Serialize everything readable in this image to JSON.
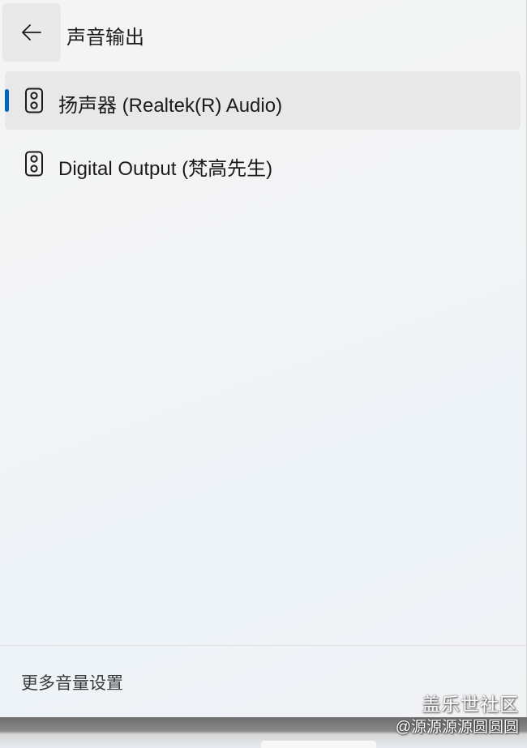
{
  "header": {
    "back_icon": "arrow-left-icon",
    "title": "声音输出"
  },
  "devices": [
    {
      "label": "扬声器 (Realtek(R) Audio)",
      "icon": "speaker-icon",
      "selected": true
    },
    {
      "label": "Digital Output (梵高先生)",
      "icon": "speaker-icon",
      "selected": false
    }
  ],
  "footer": {
    "more_settings_label": "更多音量设置"
  },
  "watermark": {
    "line1": "盖乐世社区",
    "line2": "@源源源源圆圆圆"
  },
  "colors": {
    "accent": "#0067c0",
    "selected_bg": "#e8e8e8"
  }
}
